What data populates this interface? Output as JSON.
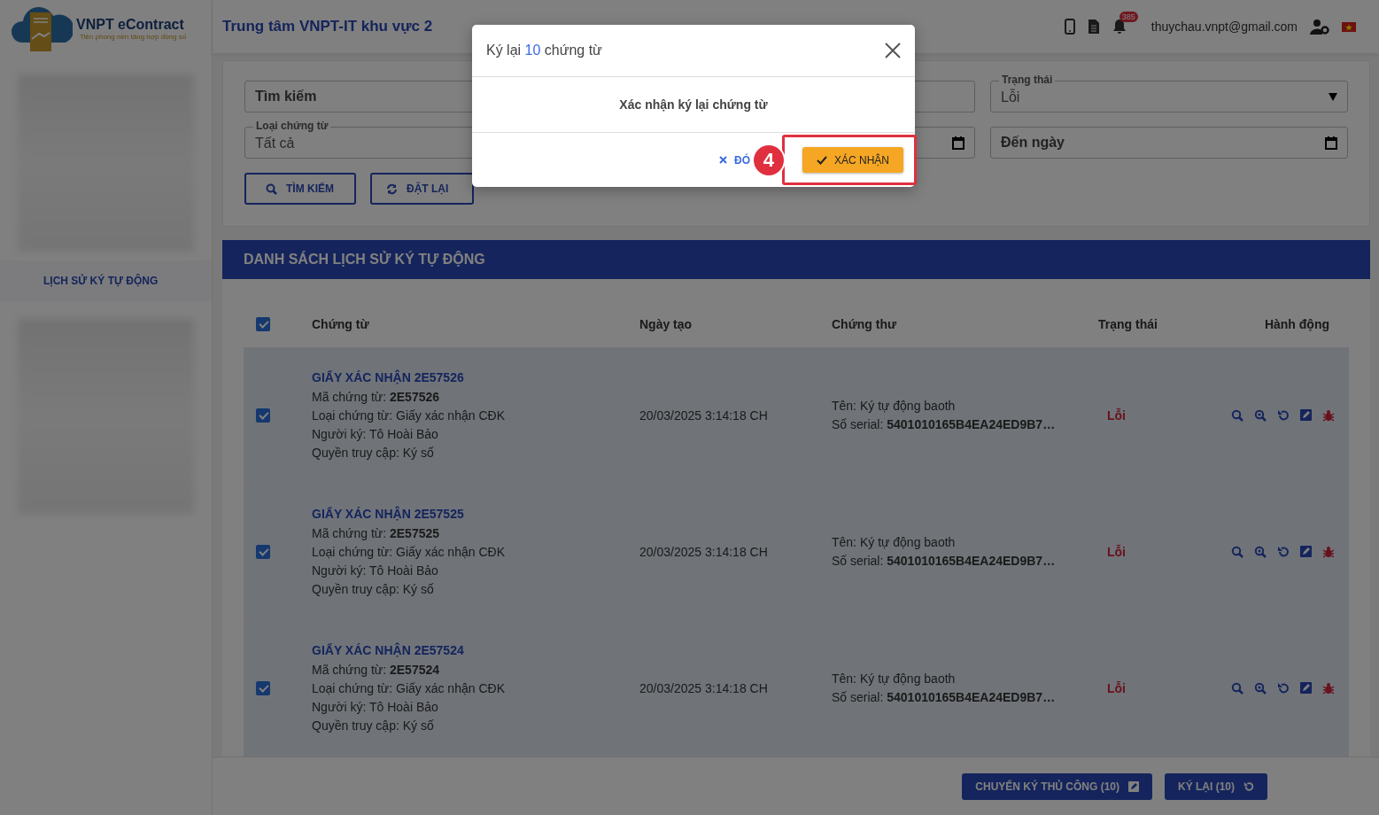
{
  "header": {
    "logo": {
      "name": "VNPT eContract",
      "tagline": "Tiên phong nền tảng hợp đồng số"
    },
    "org_title": "Trung tâm VNPT-IT khu vực 2",
    "notification_count": "385",
    "user_email": "thuychau.vnpt@gmail.com"
  },
  "sidebar": {
    "items": [
      {
        "label": "LỊCH SỬ KÝ TỰ ĐỘNG",
        "selected": true
      }
    ]
  },
  "filters": {
    "search": {
      "placeholder": "Tìm kiếm"
    },
    "doc_type": {
      "label": "Loại chứng từ",
      "value": "Tất cả"
    },
    "status": {
      "label": "Trạng thái",
      "value": "Lỗi"
    },
    "to_date": {
      "placeholder": "Đến ngày"
    },
    "buttons": [
      {
        "kind": "search",
        "label": "TÌM KIẾM"
      },
      {
        "kind": "reset",
        "label": "ĐẶT LẠI"
      }
    ]
  },
  "list": {
    "title": "DANH SÁCH LỊCH SỬ KÝ TỰ ĐỘNG",
    "select_all_checked": true,
    "columns": [
      "Chứng từ",
      "Ngày tạo",
      "Chứng thư",
      "Trạng thái",
      "Hành động"
    ],
    "rows": [
      {
        "checked": true,
        "title": "GIẤY XÁC NHẬN 2E57526",
        "lines": [
          "Mã chứng từ: **2E57526**",
          "Loại chứng từ: Giấy xác nhận CĐK",
          "Người ký: Tô Hoài Bảo",
          "Quyền truy cập: Ký số"
        ],
        "created": "20/03/2025 3:14:18 CH",
        "cert": [
          "Tên: Ký tự động baoth",
          "Số serial: **5401010165B4EA24ED9B7…**"
        ],
        "status": "Lỗi"
      },
      {
        "checked": true,
        "title": "GIẤY XÁC NHẬN 2E57525",
        "lines": [
          "Mã chứng từ: **2E57525**",
          "Loại chứng từ: Giấy xác nhận CĐK",
          "Người ký: Tô Hoài Bảo",
          "Quyền truy cập: Ký số"
        ],
        "created": "20/03/2025 3:14:18 CH",
        "cert": [
          "Tên: Ký tự động baoth",
          "Số serial: **5401010165B4EA24ED9B7…**"
        ],
        "status": "Lỗi"
      },
      {
        "checked": true,
        "title": "GIẤY XÁC NHẬN 2E57524",
        "lines": [
          "Mã chứng từ: **2E57524**",
          "Loại chứng từ: Giấy xác nhận CĐK",
          "Người ký: Tô Hoài Bảo",
          "Quyền truy cập: Ký số"
        ],
        "created": "20/03/2025 3:14:18 CH",
        "cert": [
          "Tên: Ký tự động baoth",
          "Số serial: **5401010165B4EA24ED9B7…**"
        ],
        "status": "Lỗi"
      }
    ]
  },
  "footer_actions": [
    {
      "kind": "manual",
      "label": "CHUYỂN KÝ THỦ CÔNG (10)"
    },
    {
      "kind": "resign",
      "label": "KÝ LẠI (10)"
    }
  ],
  "modal": {
    "title_prefix": "Ký lại",
    "count": "10",
    "title_suffix": "chứng từ",
    "message": "Xác nhận ký lại chứng từ",
    "cancel_label": "ĐÓ",
    "confirm_label": "XÁC NHẬN",
    "step_badge": "4"
  }
}
